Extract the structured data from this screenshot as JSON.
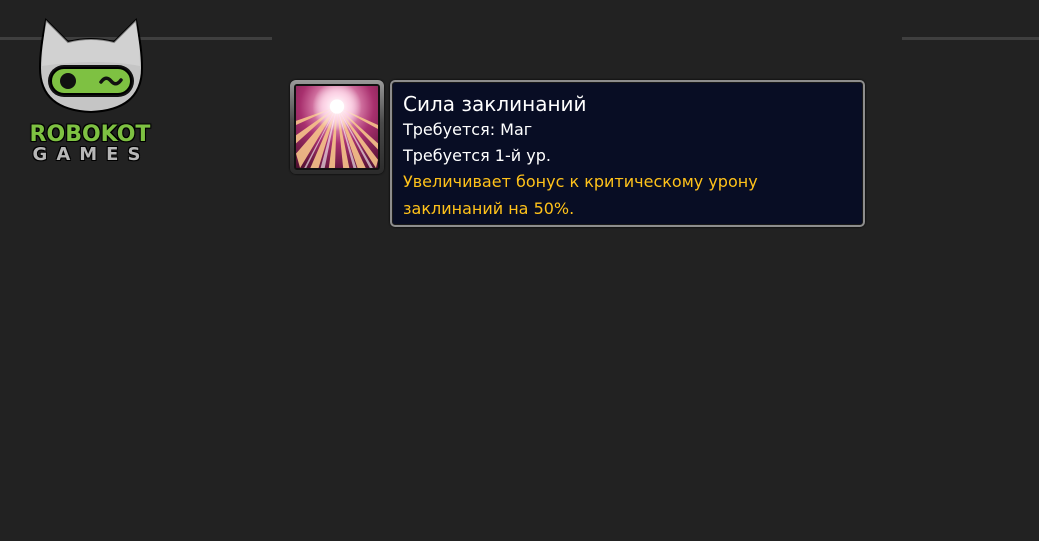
{
  "logo": {
    "brand_top": "ROBOKOT",
    "brand_bottom": "GAMES",
    "icon": "robot-cat-icon",
    "brand_green": "#7ec142"
  },
  "spell": {
    "icon": "arcane-burst-icon",
    "title": "Сила заклинаний",
    "requirement_class": "Требуется: Маг",
    "requirement_level": "Требуется 1-й ур.",
    "description": "Увеличивает бонус к критическому урону заклинаний на 50%."
  },
  "colors": {
    "background": "#222222",
    "tooltip_background": "#080d24",
    "tooltip_border": "#8d8d8d",
    "description": "#ffc21a",
    "text": "#ffffff"
  }
}
